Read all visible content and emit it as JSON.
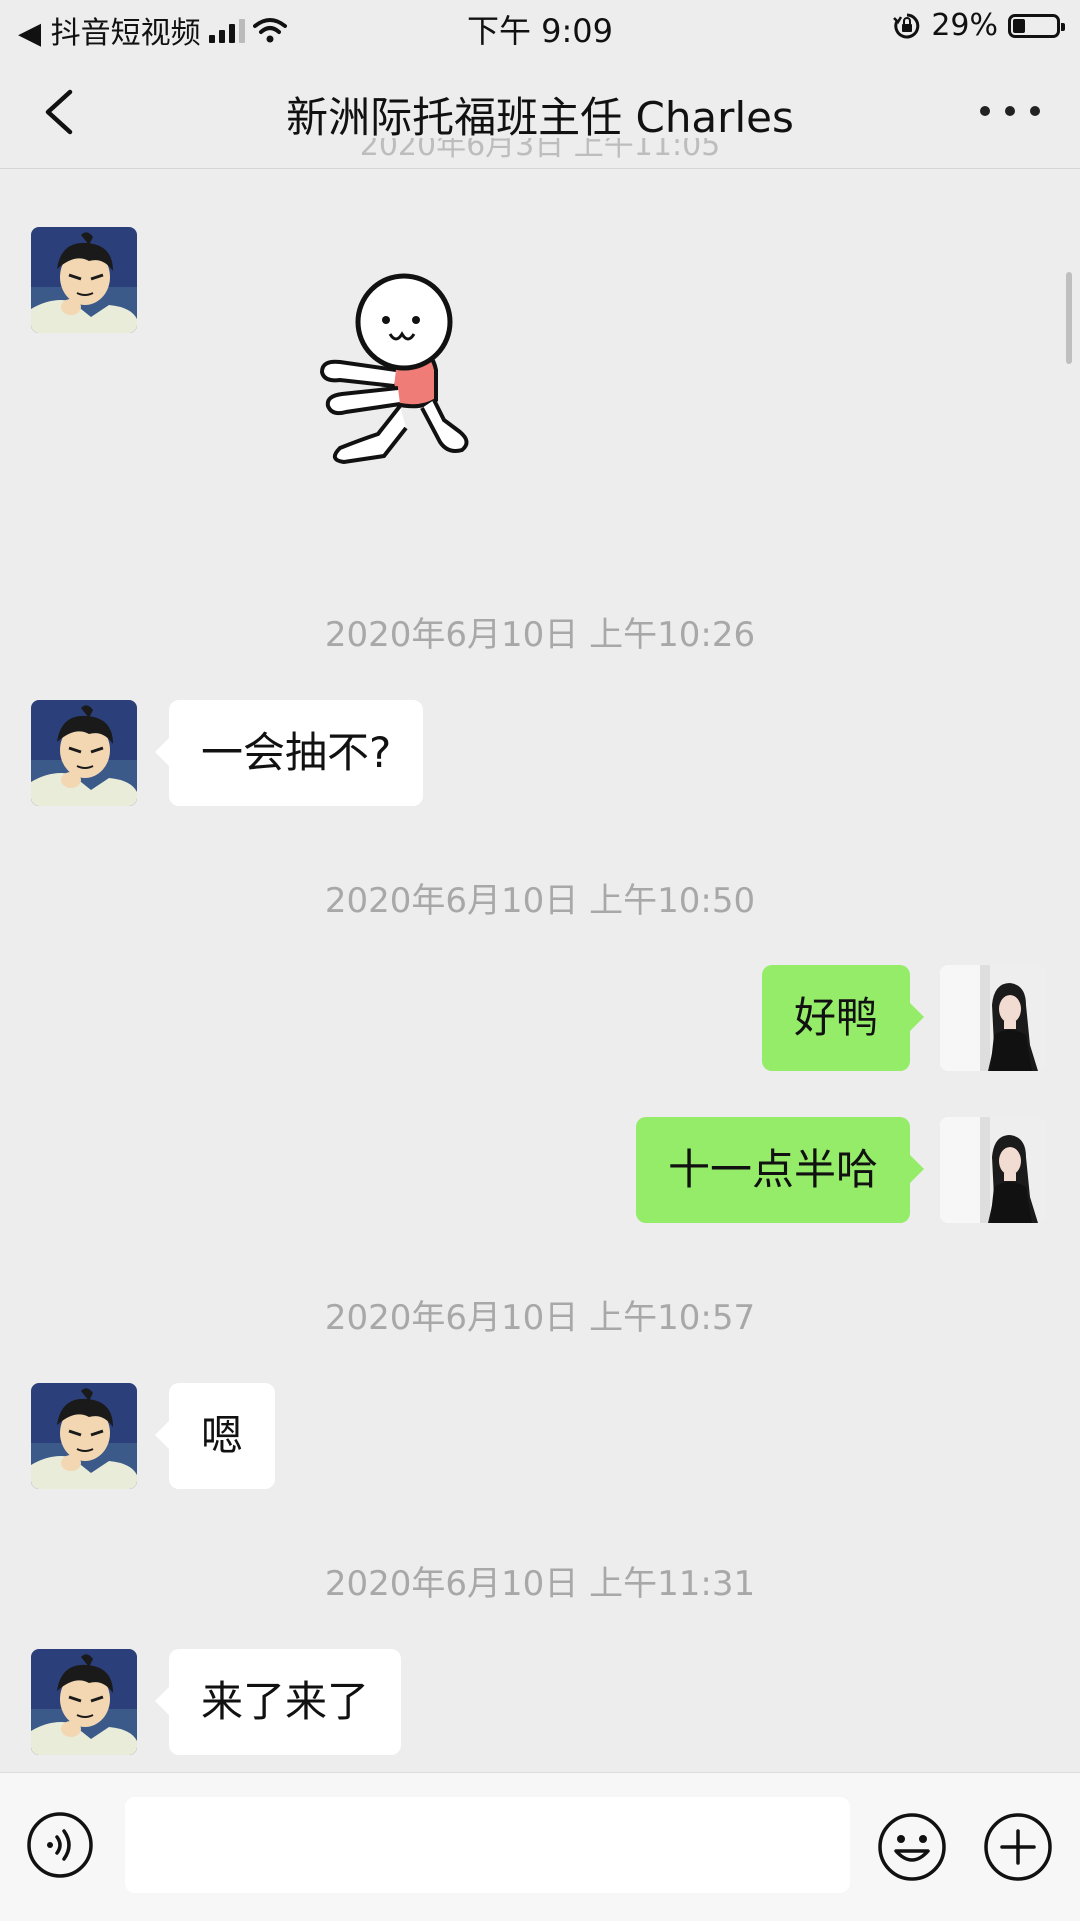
{
  "status_bar": {
    "back_app": "◀ 抖音短视频",
    "time": "下午 9:09",
    "battery": "29%",
    "battery_level": 0.29
  },
  "nav": {
    "title": "新洲际托福班主任 Charles"
  },
  "messages": [
    {
      "type": "sticker",
      "side": "left"
    },
    {
      "type": "time",
      "text": "2020年6月10日 上午10:26"
    },
    {
      "type": "text",
      "side": "left",
      "text": "一会抽不?"
    },
    {
      "type": "time",
      "text": "2020年6月10日 上午10:50"
    },
    {
      "type": "text",
      "side": "right",
      "text": "好鸭"
    },
    {
      "type": "text",
      "side": "right",
      "text": "十一点半哈"
    },
    {
      "type": "time",
      "text": "2020年6月10日 上午10:57"
    },
    {
      "type": "text",
      "side": "left",
      "text": "嗯"
    },
    {
      "type": "time",
      "text": "2020年6月10日 上午11:31"
    },
    {
      "type": "text",
      "side": "left",
      "text": "来了来了"
    }
  ],
  "icons": {
    "back": "chevron-left-icon",
    "more": "more-dots-icon",
    "voice": "voice-icon",
    "emoji": "emoji-icon",
    "plus": "plus-icon"
  },
  "colors": {
    "background": "#ededed",
    "outgoing_bubble": "#95ec69",
    "incoming_bubble": "#ffffff",
    "timestamp": "#a8a8a8"
  }
}
